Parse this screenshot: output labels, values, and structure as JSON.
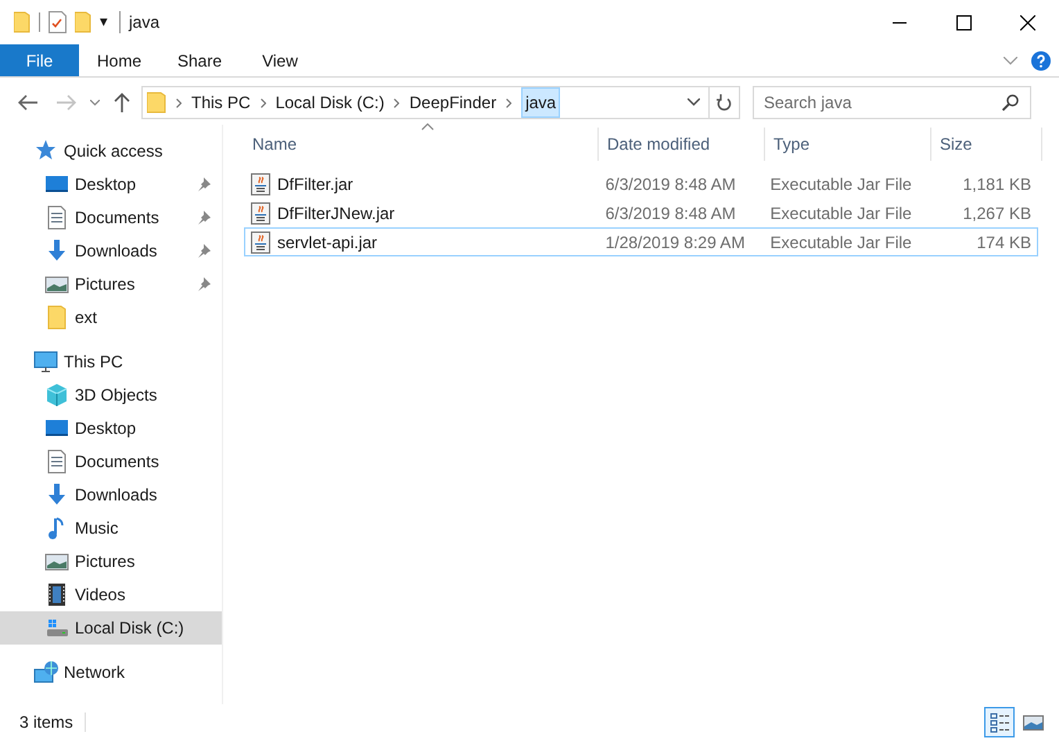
{
  "window": {
    "title": "java",
    "quick_access_toolbar": {
      "dropdown": "▾"
    }
  },
  "ribbon": {
    "tabs": [
      {
        "label": "File",
        "kind": "file",
        "selected": false
      },
      {
        "label": "Home",
        "kind": "tab",
        "selected": false
      },
      {
        "label": "Share",
        "kind": "tab",
        "selected": false
      },
      {
        "label": "View",
        "kind": "tab",
        "selected": false
      }
    ]
  },
  "address_bar": {
    "path": [
      {
        "label": "This PC",
        "current": false
      },
      {
        "label": "Local Disk (C:)",
        "current": false
      },
      {
        "label": "DeepFinder",
        "current": false
      },
      {
        "label": "java",
        "current": true
      }
    ]
  },
  "search": {
    "placeholder": "Search java"
  },
  "navigation_pane": [
    {
      "label": "Quick access",
      "kind": "star",
      "selected": false,
      "children": [
        {
          "label": "Desktop",
          "kind": "desktop",
          "pinned": true,
          "selected": false
        },
        {
          "label": "Documents",
          "kind": "document",
          "pinned": true,
          "selected": false
        },
        {
          "label": "Downloads",
          "kind": "download",
          "pinned": true,
          "selected": false
        },
        {
          "label": "Pictures",
          "kind": "pictures",
          "pinned": true,
          "selected": false
        },
        {
          "label": "ext",
          "kind": "folder",
          "pinned": false,
          "selected": false
        }
      ]
    },
    {
      "label": "This PC",
      "kind": "pc",
      "selected": false,
      "children": [
        {
          "label": "3D Objects",
          "kind": "cube",
          "pinned": false,
          "selected": false
        },
        {
          "label": "Desktop",
          "kind": "desktop",
          "pinned": false,
          "selected": false
        },
        {
          "label": "Documents",
          "kind": "document",
          "pinned": false,
          "selected": false
        },
        {
          "label": "Downloads",
          "kind": "download",
          "pinned": false,
          "selected": false
        },
        {
          "label": "Music",
          "kind": "music",
          "pinned": false,
          "selected": false
        },
        {
          "label": "Pictures",
          "kind": "pictures",
          "pinned": false,
          "selected": false
        },
        {
          "label": "Videos",
          "kind": "video",
          "pinned": false,
          "selected": false
        },
        {
          "label": "Local Disk (C:)",
          "kind": "drive",
          "pinned": false,
          "selected": true
        }
      ]
    },
    {
      "label": "Network",
      "kind": "network",
      "selected": false
    }
  ],
  "file_list": {
    "columns": [
      {
        "label": "Name",
        "sorted": true
      },
      {
        "label": "Date modified",
        "sorted": false
      },
      {
        "label": "Type",
        "sorted": false
      },
      {
        "label": "Size",
        "sorted": false
      }
    ],
    "rows": [
      {
        "name": "DfFilter.jar",
        "date_modified": "6/3/2019 8:48 AM",
        "type": "Executable Jar File",
        "size": "1,181 KB",
        "focused": false
      },
      {
        "name": "DfFilterJNew.jar",
        "date_modified": "6/3/2019 8:48 AM",
        "type": "Executable Jar File",
        "size": "1,267 KB",
        "focused": false
      },
      {
        "name": "servlet-api.jar",
        "date_modified": "1/28/2019 8:29 AM",
        "type": "Executable Jar File",
        "size": "174 KB",
        "focused": true
      }
    ]
  },
  "status_bar": {
    "item_count": "3 items",
    "views": [
      {
        "kind": "details",
        "selected": true
      },
      {
        "kind": "large_icons",
        "selected": false
      }
    ]
  }
}
